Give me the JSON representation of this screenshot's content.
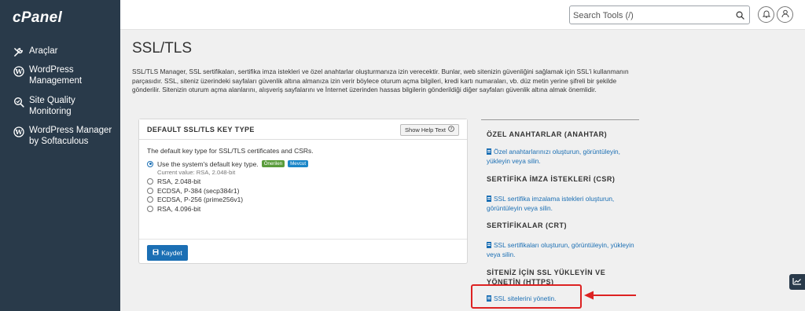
{
  "brand": "cPanel",
  "sidebar": {
    "items": [
      {
        "icon": "wrench-icon",
        "label": "Araçlar"
      },
      {
        "icon": "wordpress-icon",
        "label": "WordPress Management"
      },
      {
        "icon": "magnifier-icon",
        "label": "Site Quality Monitoring"
      },
      {
        "icon": "wordpress-icon",
        "label": "WordPress Manager by Softaculous"
      }
    ]
  },
  "header": {
    "search_placeholder": "Search Tools (/)",
    "icons": [
      "search-icon",
      "bell-icon",
      "user-icon"
    ]
  },
  "main": {
    "title": "SSL/TLS",
    "intro": "SSL/TLS Manager, SSL sertifikaları, sertifika imza istekleri ve özel anahtarlar oluşturmanıza izin verecektir. Bunlar, web sitenizin güvenliğini sağlamak için SSL'i kullanmanın parçasıdır. SSL, siteniz üzerindeki sayfaları güvenlik altına almanıza izin verir böylece oturum açma bilgileri, kredi kartı numaraları, vb. düz metin yerine şifreli bir şekilde gönderilir. Sitenizin oturum açma alanlarını, alışveriş sayfalarını ve İnternet üzerinden hassas bilgilerin gönderildiği diğer sayfaları güvenlik altına almak önemlidir."
  },
  "panel": {
    "title": "DEFAULT SSL/TLS KEY TYPE",
    "help_label": "Show Help Text",
    "description": "The default key type for SSL/TLS certificates and CSRs.",
    "options": [
      {
        "label": "Use the system's default key type.",
        "selected": true,
        "badges": [
          "Önerilen",
          "Mevcut"
        ]
      },
      {
        "label": "RSA, 2.048-bit",
        "selected": false
      },
      {
        "label": "ECDSA, P-384 (secp384r1)",
        "selected": false
      },
      {
        "label": "ECDSA, P-256 (prime256v1)",
        "selected": false
      },
      {
        "label": "RSA, 4.096-bit",
        "selected": false
      }
    ],
    "current_value": "Current value: RSA, 2.048-bit",
    "save_label": "Kaydet"
  },
  "right": {
    "sections": [
      {
        "heading": "ÖZEL ANAHTARLAR (ANAHTAR)",
        "link": "Özel anahtarlarınızı oluşturun, görüntüleyin, yükleyin veya silin."
      },
      {
        "heading": "SERTİFİKA İMZA İSTEKLERİ (CSR)",
        "link": "SSL sertifika imzalama istekleri oluşturun, görüntüleyin veya silin."
      },
      {
        "heading": "SERTİFİKALAR (CRT)",
        "link": "SSL sertifikaları oluşturun, görüntüleyin, yükleyin veya silin."
      },
      {
        "heading": "SİTENİZ İÇİN SSL YÜKLEYİN VE YÖNETİN (HTTPS)",
        "link": "SSL sitelerini yönetin."
      }
    ]
  },
  "colors": {
    "sidebar_bg": "#293a4a",
    "link": "#1b6fb4",
    "badge_recommended": "#5a9c3b",
    "badge_current": "#1b86c8",
    "highlight": "#dd2222"
  }
}
